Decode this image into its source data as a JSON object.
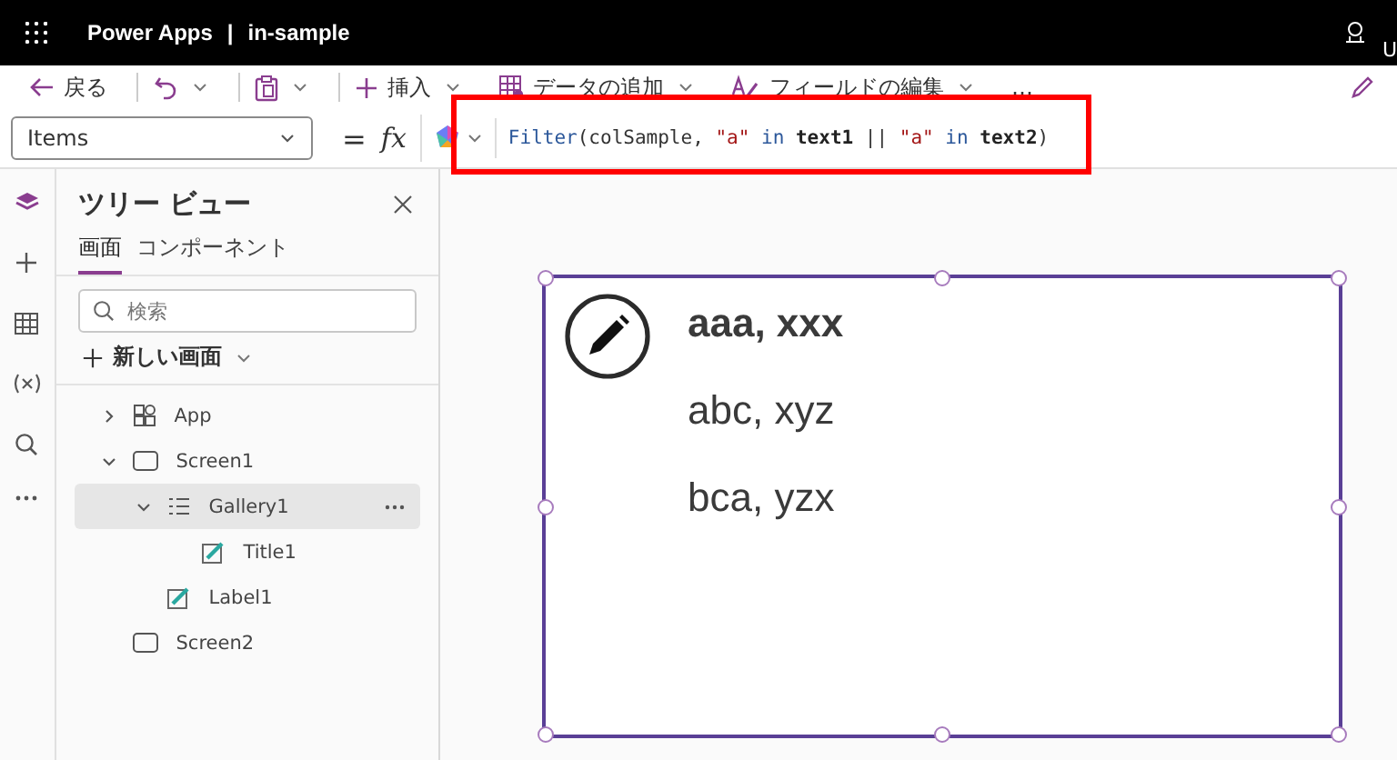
{
  "header": {
    "app_name": "Power Apps",
    "separator": "|",
    "file_name": "in-sample",
    "user_initial": "U"
  },
  "toolbar": [
    {
      "kind": "back",
      "label": "戻る"
    },
    {
      "kind": "undo",
      "dropdown": true
    },
    {
      "kind": "paste",
      "dropdown": true
    },
    {
      "kind": "insert",
      "label": "挿入",
      "dropdown": true
    },
    {
      "kind": "data",
      "label": "データの追加",
      "dropdown": true
    },
    {
      "kind": "fields",
      "label": "フィールドの編集",
      "dropdown": true
    },
    {
      "kind": "more",
      "label": "…"
    }
  ],
  "formula_bar": {
    "property": "Items",
    "equals": "=",
    "fx": "fx",
    "tokens": [
      {
        "kind": "function",
        "text": "Filter"
      },
      {
        "kind": "plain",
        "text": "(colSample, "
      },
      {
        "kind": "string",
        "text": "\"a\""
      },
      {
        "kind": "keyword",
        "text": " in "
      },
      {
        "kind": "name",
        "text": "text1"
      },
      {
        "kind": "plain",
        "text": " || "
      },
      {
        "kind": "string",
        "text": "\"a\""
      },
      {
        "kind": "keyword",
        "text": " in "
      },
      {
        "kind": "name",
        "text": "text2"
      },
      {
        "kind": "plain",
        "text": ")"
      }
    ]
  },
  "tree_view": {
    "title": "ツリー ビュー",
    "tabs": [
      {
        "label": "画面",
        "selected": true
      },
      {
        "label": "コンポーネント",
        "selected": false
      }
    ],
    "search": {
      "placeholder": "検索"
    },
    "new_screen": "新しい画面",
    "items": [
      {
        "kind": "app",
        "label": "App",
        "expanded": false,
        "selected": false
      },
      {
        "kind": "screen",
        "label": "Screen1",
        "expanded": true,
        "selected": false,
        "children": [
          {
            "kind": "gallery",
            "label": "Gallery1",
            "expanded": true,
            "selected": true,
            "children": [
              {
                "kind": "label",
                "label": "Title1",
                "selected": false
              }
            ]
          },
          {
            "kind": "label",
            "label": "Label1",
            "selected": false
          }
        ]
      },
      {
        "kind": "screen",
        "label": "Screen2",
        "selected": false
      }
    ]
  },
  "gallery": {
    "rows": [
      {
        "text": "aaa, xxx",
        "bold": true
      },
      {
        "text": "abc, xyz",
        "bold": false
      },
      {
        "text": "bca, yzx",
        "bold": false
      }
    ]
  }
}
